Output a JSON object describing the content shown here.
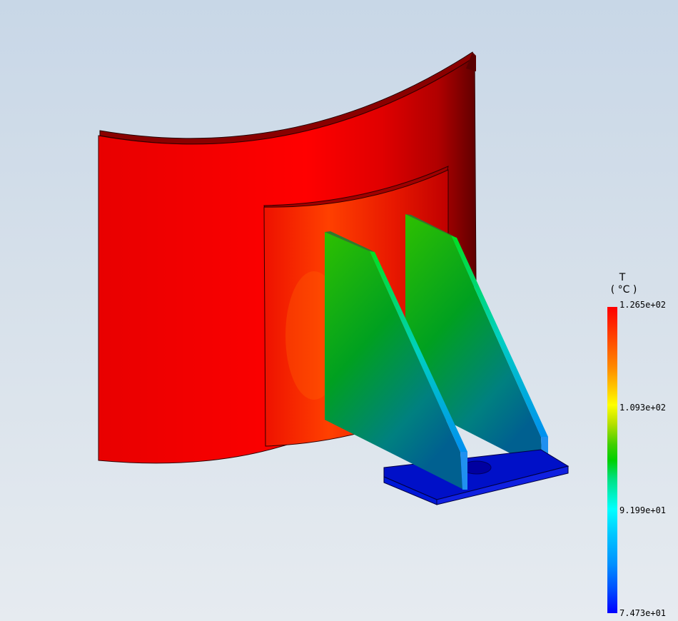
{
  "legend": {
    "title": "T",
    "unit": "( °C )",
    "labels": {
      "max": "1.265e+02",
      "upper": "1.093e+02",
      "lower": "9.199e+01",
      "min": "7.473e+01"
    },
    "colors": {
      "hot": "#ff0000",
      "warm": "#ffff00",
      "mid": "#00d000",
      "cool": "#00ffff",
      "cold": "#0000ff"
    }
  }
}
